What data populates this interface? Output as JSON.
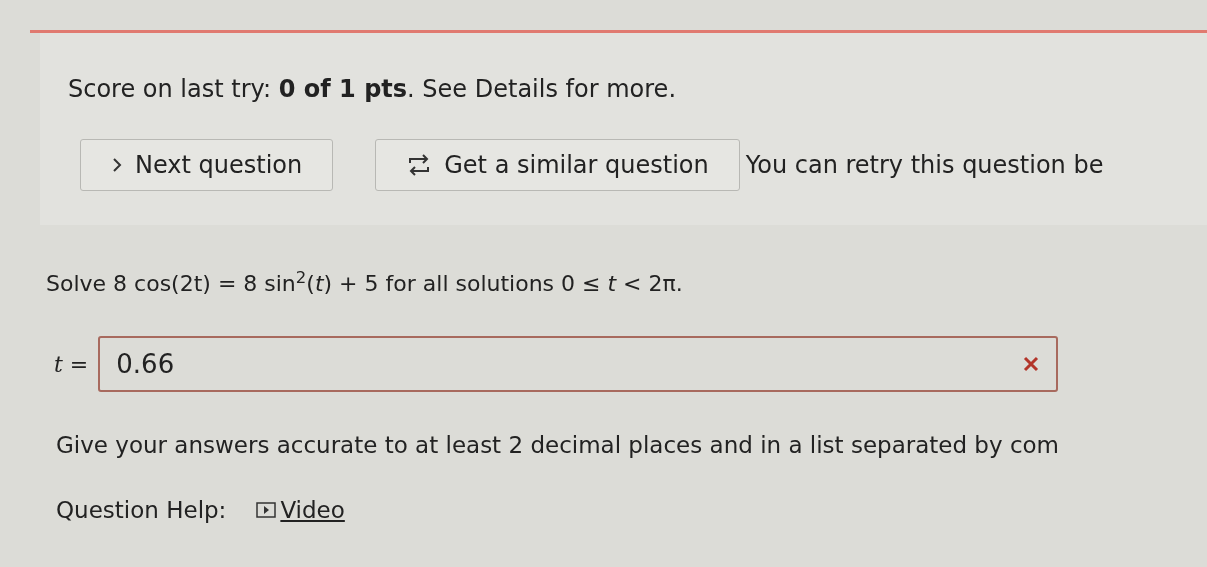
{
  "score": "Score on last try: **0 of 1 pts**. See Details for more.",
  "buttons": [
    {
      "kind": "next",
      "label": "Next question"
    },
    {
      "kind": "similar",
      "label": "Get a similar question"
    }
  ],
  "retry_note": "You can retry this question be",
  "question": "Solve 8 cos(2t) = 8 sin$^{2}$(*t*) + 5 for all solutions 0 ≤ *t* < 2π.",
  "answer": {
    "label": "t =",
    "value": "0.66",
    "correct": false
  },
  "instructions": "Give your answers accurate to at least 2 decimal places and in a list separated by com",
  "help": {
    "label": "Question Help:",
    "link": "Video"
  }
}
